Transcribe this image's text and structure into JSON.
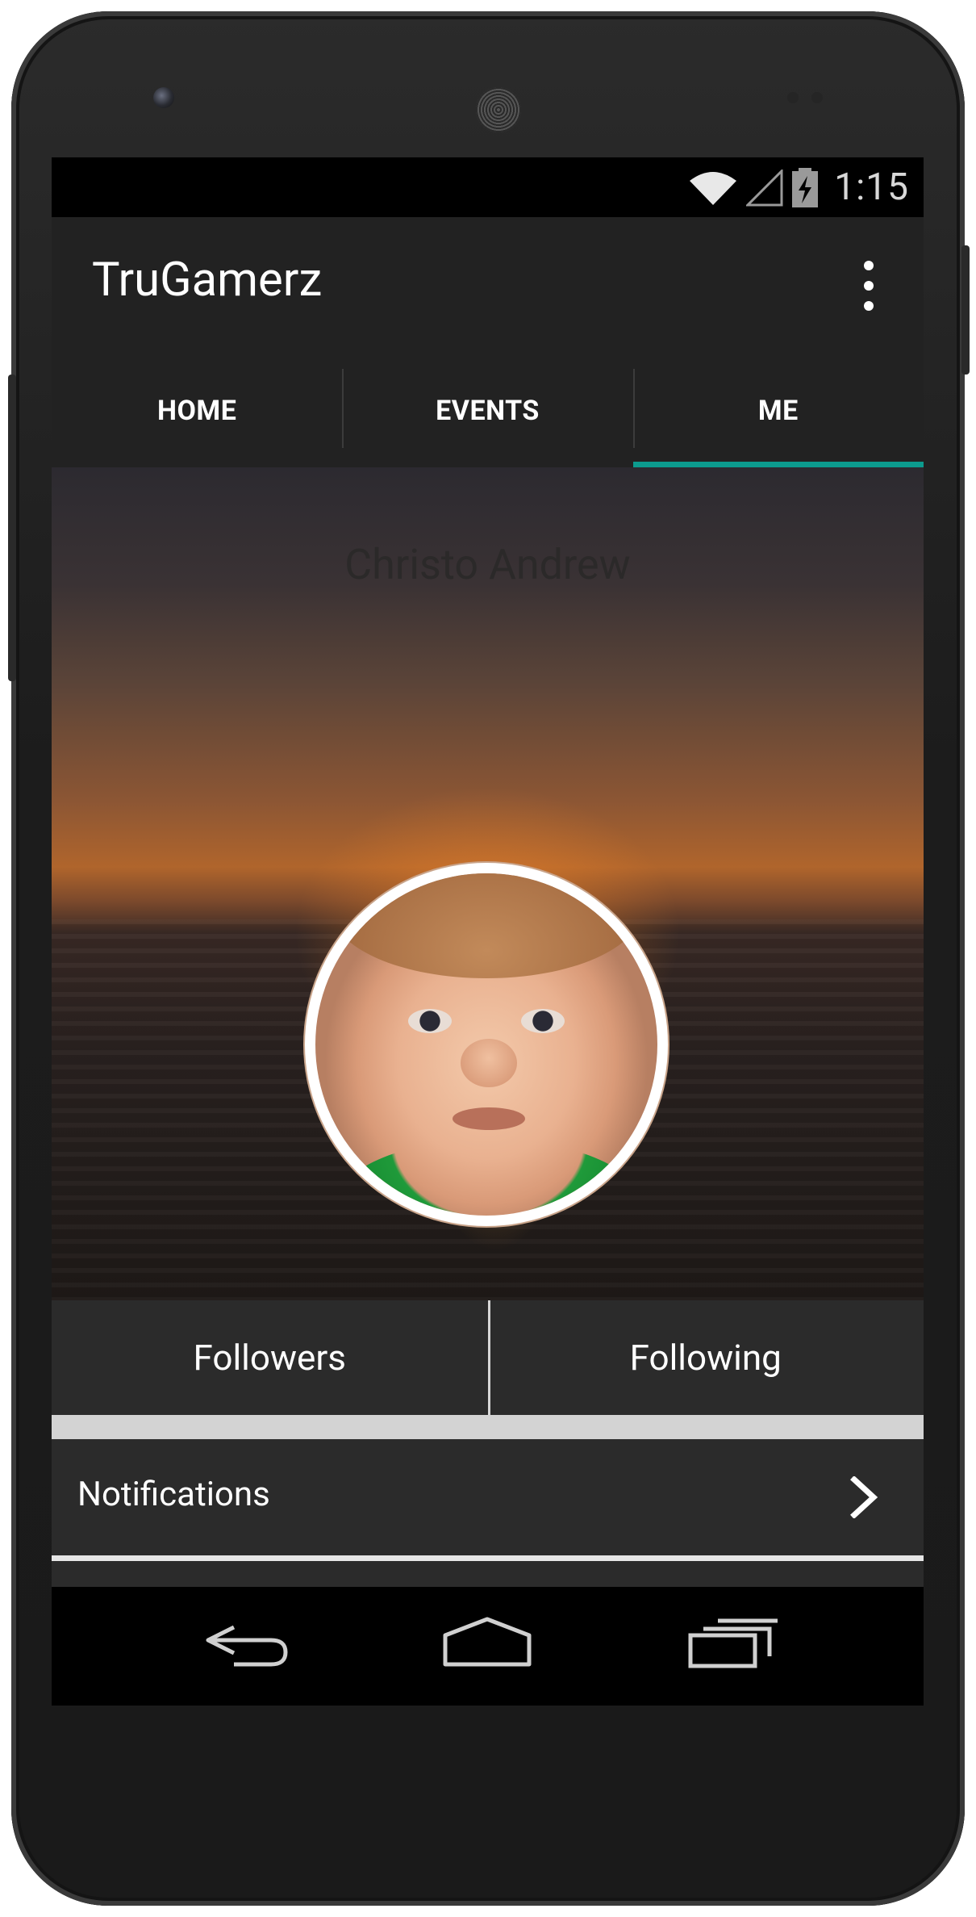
{
  "status_bar": {
    "time": "1:15",
    "icons": [
      "wifi-icon",
      "signal-icon",
      "battery-charging-icon"
    ]
  },
  "app_bar": {
    "title": "TruGamerz",
    "overflow_icon": "overflow-menu-icon"
  },
  "tabs": [
    {
      "label": "HOME",
      "active": false
    },
    {
      "label": "EVENTS",
      "active": false
    },
    {
      "label": "ME",
      "active": true
    }
  ],
  "accent_color": "#0c9b8e",
  "profile": {
    "name": "Christo Andrew",
    "avatar": "profile-avatar"
  },
  "follow": {
    "followers_label": "Followers",
    "following_label": "Following"
  },
  "notifications": {
    "label": "Notifications",
    "icon": "chevron-right-icon"
  },
  "nav_bar": {
    "back": "back-icon",
    "home": "home-icon",
    "recents": "recents-icon"
  }
}
